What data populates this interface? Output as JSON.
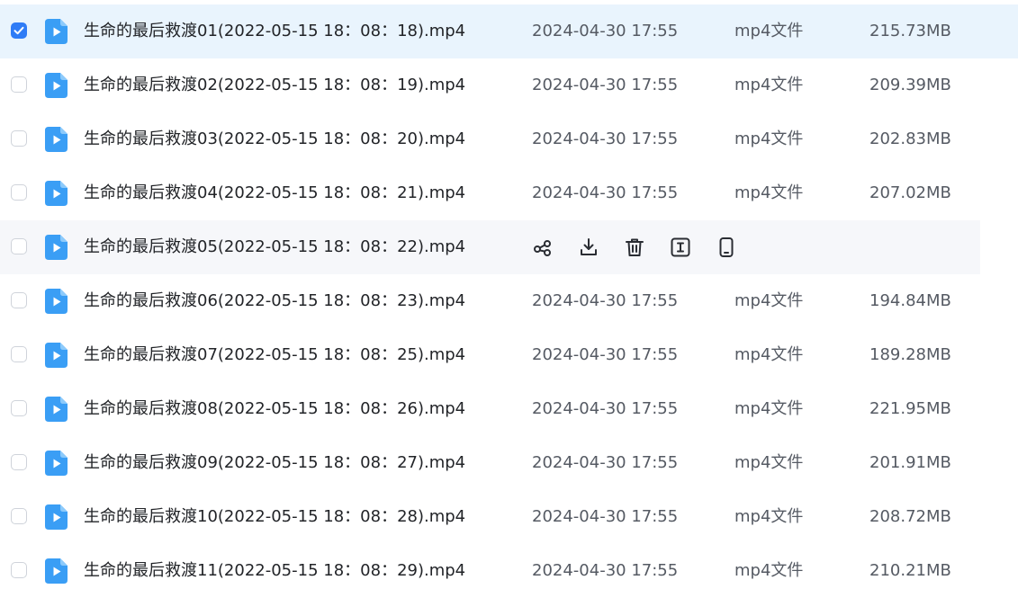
{
  "files": [
    {
      "name": "生命的最后救渡01(2022-05-15 18：08：18).mp4",
      "date": "2024-04-30 17:55",
      "type": "mp4文件",
      "size": "215.73MB",
      "checked": true,
      "state": "selected"
    },
    {
      "name": "生命的最后救渡02(2022-05-15 18：08：19).mp4",
      "date": "2024-04-30 17:55",
      "type": "mp4文件",
      "size": "209.39MB",
      "checked": false,
      "state": "normal"
    },
    {
      "name": "生命的最后救渡03(2022-05-15 18：08：20).mp4",
      "date": "2024-04-30 17:55",
      "type": "mp4文件",
      "size": "202.83MB",
      "checked": false,
      "state": "normal"
    },
    {
      "name": "生命的最后救渡04(2022-05-15 18：08：21).mp4",
      "date": "2024-04-30 17:55",
      "type": "mp4文件",
      "size": "207.02MB",
      "checked": false,
      "state": "normal"
    },
    {
      "name": "生命的最后救渡05(2022-05-15 18：08：22).mp4",
      "checked": false,
      "state": "hovered"
    },
    {
      "name": "生命的最后救渡06(2022-05-15 18：08：23).mp4",
      "date": "2024-04-30 17:55",
      "type": "mp4文件",
      "size": "194.84MB",
      "checked": false,
      "state": "normal"
    },
    {
      "name": "生命的最后救渡07(2022-05-15 18：08：25).mp4",
      "date": "2024-04-30 17:55",
      "type": "mp4文件",
      "size": "189.28MB",
      "checked": false,
      "state": "normal"
    },
    {
      "name": "生命的最后救渡08(2022-05-15 18：08：26).mp4",
      "date": "2024-04-30 17:55",
      "type": "mp4文件",
      "size": "221.95MB",
      "checked": false,
      "state": "normal"
    },
    {
      "name": "生命的最后救渡09(2022-05-15 18：08：27).mp4",
      "date": "2024-04-30 17:55",
      "type": "mp4文件",
      "size": "201.91MB",
      "checked": false,
      "state": "normal"
    },
    {
      "name": "生命的最后救渡10(2022-05-15 18：08：28).mp4",
      "date": "2024-04-30 17:55",
      "type": "mp4文件",
      "size": "208.72MB",
      "checked": false,
      "state": "normal"
    },
    {
      "name": "生命的最后救渡11(2022-05-15 18：08：29).mp4",
      "date": "2024-04-30 17:55",
      "type": "mp4文件",
      "size": "210.21MB",
      "checked": false,
      "state": "normal"
    }
  ],
  "hover_actions": [
    {
      "icon": "share-icon"
    },
    {
      "icon": "download-icon"
    },
    {
      "icon": "delete-icon"
    },
    {
      "icon": "rename-icon"
    },
    {
      "icon": "send-to-phone-icon"
    }
  ],
  "colors": {
    "accent": "#2f7cf6",
    "selected_row_bg": "#e9f4fd",
    "hover_row_bg": "#f6f7fa",
    "file_icon": "#3a9ef5"
  }
}
